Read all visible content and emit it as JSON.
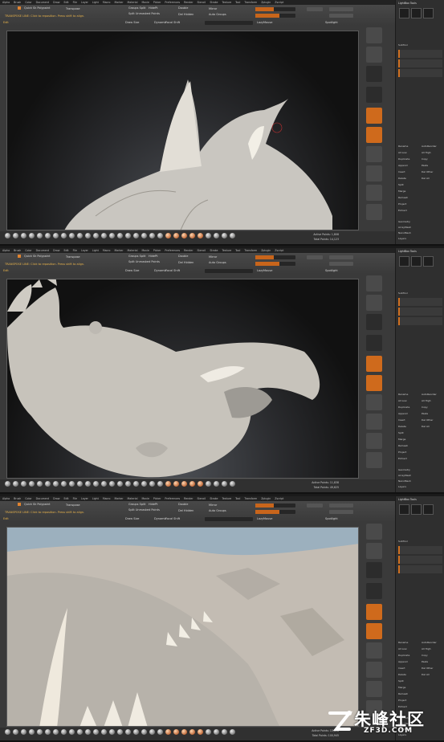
{
  "menu": [
    "Alpha",
    "Brush",
    "Color",
    "Document",
    "Draw",
    "Edit",
    "File",
    "Layer",
    "Light",
    "Macro",
    "Marker",
    "Material",
    "Movie",
    "Picker",
    "Preferences",
    "Render",
    "Stencil",
    "Stroke",
    "Texture",
    "Tool",
    "Transform",
    "Zplugin",
    "Zscript"
  ],
  "panels": [
    {
      "points_label": "Active Points: 1,808",
      "total_label": "Total Points: 14,123",
      "tray_title": "LightBox Tools",
      "hint": "TRANSPOSE LINE: Click to reposition. Press shift to align."
    },
    {
      "points_label": "Active Points: 11,838",
      "total_label": "Total Points: 49,625",
      "tray_title": "LightBox Tools",
      "hint": "TRANSPOSE LINE: Click to reposition. Press shift to align."
    },
    {
      "points_label": "Active Points: 13,818",
      "total_label": "Total Points: 100,945",
      "tray_title": "LightBox Tools",
      "hint": "TRANSPOSE LINE: Click to reposition. Press shift to align."
    }
  ],
  "toolbar": {
    "quick_label": "Quick Sk Polypaint",
    "transpose_label": "Transpose",
    "groups_split": "Groups Split",
    "hide_pt": "HidePt",
    "unmasked": "Split Unmasked Points",
    "double": "Double",
    "del_hidden": "Del Hidden",
    "mirror": "Mirror",
    "auto_groups": "Auto Groups",
    "draw_size": "Draw Size",
    "dynamic": "Dynamic",
    "focal_shift": "Focal Shift",
    "edit_label": "Edit",
    "lazy_mouse": "LazyMouse",
    "spotlight": "Spotlight"
  },
  "tray": {
    "subtool": "SubTool",
    "items_left": [
      "Rename",
      "All Low",
      "Duplicate",
      "Append",
      "Insert",
      "Delete",
      "Split",
      "Merge",
      "Remesh",
      "Project",
      "Extract"
    ],
    "items_right": [
      "AutoReorder",
      "All High",
      "Copy",
      "Paste",
      "Del Other",
      "Del All",
      "",
      "",
      "",
      "",
      ""
    ],
    "footer": [
      "Geometry",
      "ArrayMesh",
      "NanoMesh",
      "Layers"
    ]
  },
  "watermark": {
    "cn": "朱峰社区",
    "en": "ZF3D.COM"
  },
  "colors": {
    "accent": "#cf6a1c",
    "clay": "#c8c4bc"
  }
}
